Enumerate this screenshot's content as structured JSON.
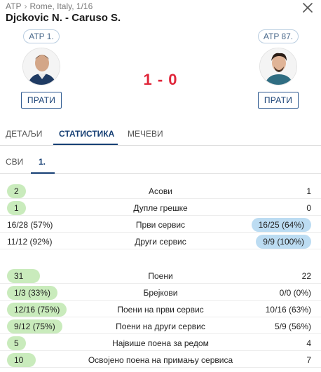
{
  "header": {
    "breadcrumb": {
      "sport": "ATP",
      "tournament": "Rome, Italy, 1/16"
    },
    "title": "Djckovic N. - Caruso S.",
    "close_icon": "close-icon"
  },
  "players": {
    "home": {
      "rank": "ATP 1.",
      "follow_label": "ПРАТИ",
      "avatar_icon": "player-avatar"
    },
    "away": {
      "rank": "ATP 87.",
      "follow_label": "ПРАТИ",
      "avatar_icon": "player-avatar"
    }
  },
  "score": "1 - 0",
  "tabs": [
    {
      "label": "ДЕТАЉИ",
      "active": false
    },
    {
      "label": "СТАТИСТИКА",
      "active": true
    },
    {
      "label": "МЕЧЕВИ",
      "active": false
    }
  ],
  "subtabs": [
    {
      "label": "СВИ",
      "active": false
    },
    {
      "label": "1.",
      "active": true
    }
  ],
  "colors": {
    "accent": "#163f74",
    "score": "#e0263a",
    "home_highlight": "#c9ebbc",
    "away_highlight": "#bcdcf2"
  },
  "stats": [
    {
      "label": "Асови",
      "home": "2",
      "away": "1",
      "better": "home"
    },
    {
      "label": "Дупле грешке",
      "home": "1",
      "away": "0",
      "better": "home"
    },
    {
      "label": "Први сервис",
      "home": "16/28 (57%)",
      "away": "16/25 (64%)",
      "better": "away"
    },
    {
      "label": "Други сервис",
      "home": "11/12 (92%)",
      "away": "9/9 (100%)",
      "better": "away"
    },
    {
      "label": "Поени",
      "home": "31",
      "away": "22",
      "better": "home"
    },
    {
      "label": "Брејкови",
      "home": "1/3 (33%)",
      "away": "0/0 (0%)",
      "better": "home"
    },
    {
      "label": "Поени на први сервис",
      "home": "12/16 (75%)",
      "away": "10/16 (63%)",
      "better": "home"
    },
    {
      "label": "Поени на други сервис",
      "home": "9/12 (75%)",
      "away": "5/9 (56%)",
      "better": "home"
    },
    {
      "label": "Највише поена за редом",
      "home": "5",
      "away": "4",
      "better": "home"
    },
    {
      "label": "Освојено поена на примању сервиса",
      "home": "10",
      "away": "7",
      "better": "home"
    }
  ]
}
